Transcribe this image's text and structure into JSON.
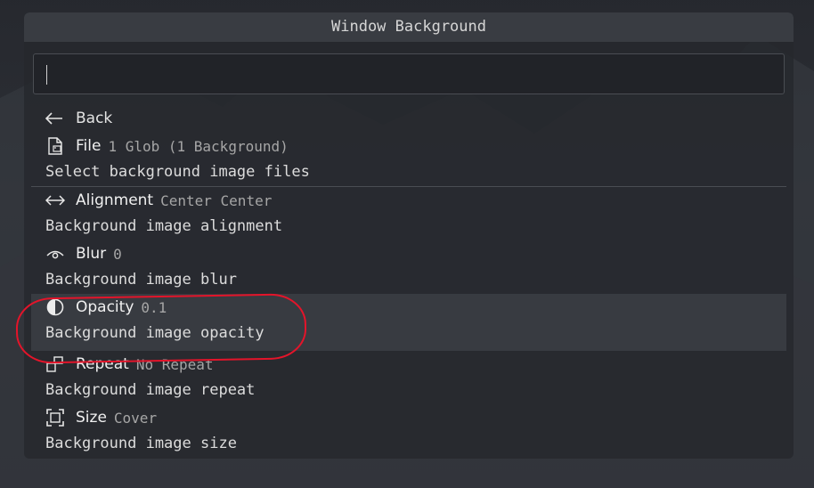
{
  "title": "Window Background",
  "search": {
    "value": ""
  },
  "back": {
    "label": "Back"
  },
  "items": [
    {
      "icon": "image-file-icon",
      "name": "File",
      "value": "1 Glob (1 Background)",
      "description": "Select background image files"
    },
    {
      "icon": "horizontal-arrows-icon",
      "name": "Alignment",
      "value": "Center Center",
      "description": "Background image alignment"
    },
    {
      "icon": "eye-icon",
      "name": "Blur",
      "value": "0",
      "description": "Background image blur"
    },
    {
      "icon": "half-circle-icon",
      "name": "Opacity",
      "value": "0.1",
      "description": "Background image opacity"
    },
    {
      "icon": "repeat-icon",
      "name": "Repeat",
      "value": "No Repeat",
      "description": "Background image repeat"
    },
    {
      "icon": "size-frame-icon",
      "name": "Size",
      "value": "Cover",
      "description": "Background image size"
    }
  ],
  "selected_item": "Opacity",
  "annotation_color": "#e4142a"
}
